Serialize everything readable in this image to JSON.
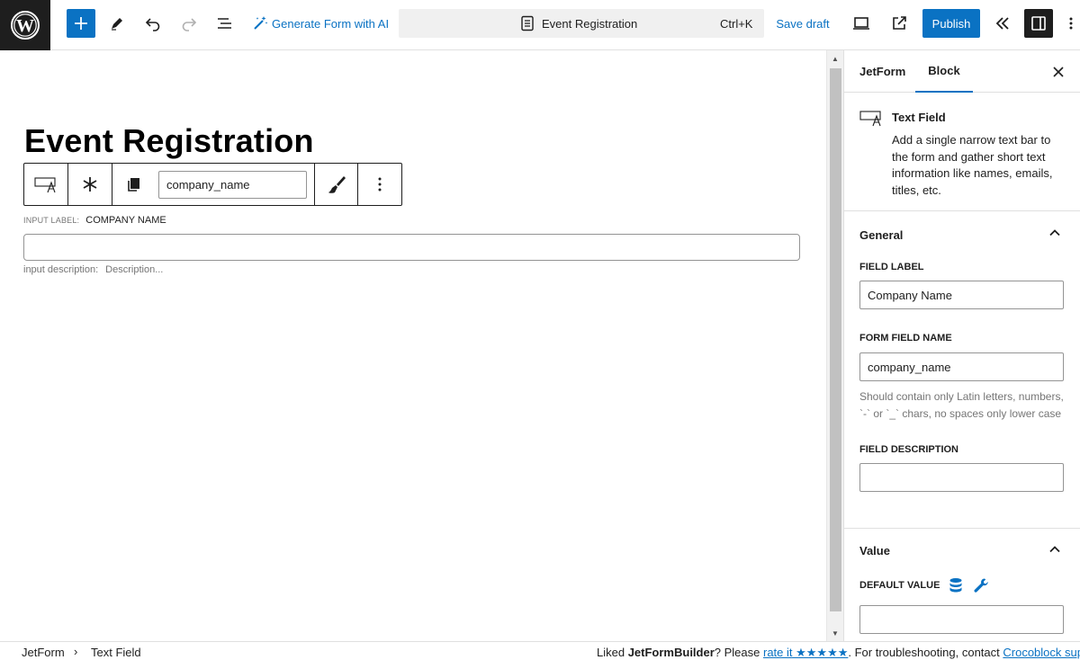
{
  "toolbar": {
    "generate_ai_label": "Generate Form with AI",
    "doc_title": "Event Registration",
    "shortcut": "Ctrl+K",
    "save_draft_label": "Save draft",
    "publish_label": "Publish"
  },
  "canvas": {
    "post_title": "Event Registration",
    "block_toolbar": {
      "field_name_value": "company_name"
    },
    "field": {
      "label_key": "input label:",
      "label_value": "COMPANY NAME",
      "desc_key": "input description:",
      "desc_value": "Description..."
    }
  },
  "sidebar": {
    "tabs": [
      {
        "label": "JetForm",
        "active": false
      },
      {
        "label": "Block",
        "active": true
      }
    ],
    "block_card": {
      "title": "Text Field",
      "description": "Add a single narrow text bar to the form and gather short text information like names, emails, titles, etc."
    },
    "general": {
      "heading": "General",
      "field_label_title": "FIELD LABEL",
      "field_label_value": "Company Name",
      "form_field_name_title": "FORM FIELD NAME",
      "form_field_name_value": "company_name",
      "form_field_name_help": "Should contain only Latin letters, numbers, `-` or `_` chars, no spaces only lower case",
      "field_description_title": "FIELD DESCRIPTION",
      "field_description_value": ""
    },
    "value": {
      "heading": "Value",
      "default_value_title": "DEFAULT VALUE",
      "default_value_value": ""
    }
  },
  "footer": {
    "breadcrumb": [
      "JetForm",
      "Text Field"
    ],
    "note_prefix": "Liked ",
    "note_brand": "JetFormBuilder",
    "note_mid": "? Please ",
    "note_rate": "rate it ★★★★★",
    "note_suffix": ". For troubleshooting, contact ",
    "note_contact": "Crocoblock support"
  },
  "colors": {
    "accent": "#0a72c3",
    "dark": "#1e1e1e",
    "muted": "#757575",
    "border": "#e0e0e0"
  },
  "icons": [
    "wordpress-logo",
    "plus-icon",
    "pencil-icon",
    "undo-icon",
    "redo-icon",
    "list-view-icon",
    "ai-wand-icon",
    "document-icon",
    "desktop-view-icon",
    "external-link-icon",
    "collapse-icon",
    "sidebar-toggle-icon",
    "text-field-icon",
    "asterisk-icon",
    "copy-icon",
    "brush-icon",
    "more-vertical-icon",
    "close-icon",
    "chevron-up-icon",
    "database-icon",
    "wrench-icon"
  ]
}
